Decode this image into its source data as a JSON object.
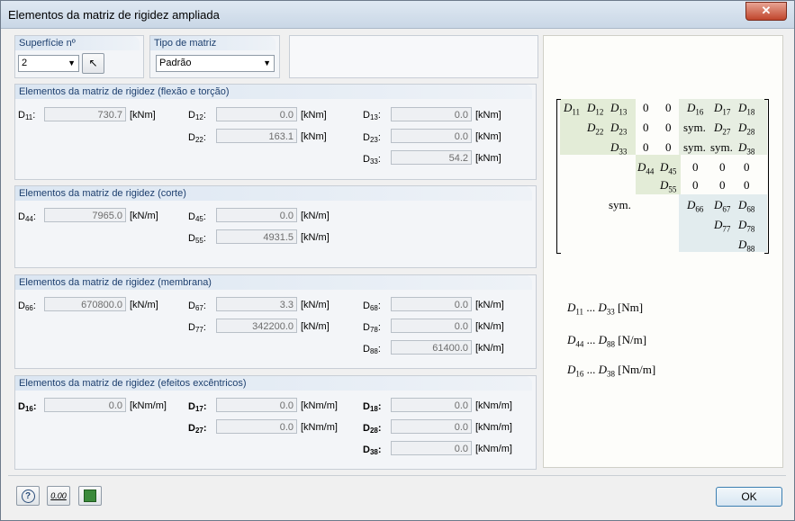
{
  "window": {
    "title": "Elementos da matriz de rigidez ampliada",
    "close": "✕"
  },
  "surface": {
    "label": "Superfície nº",
    "value": "2"
  },
  "matrix_type": {
    "label": "Tipo de matriz",
    "value": "Padrão"
  },
  "bending": {
    "title": "Elementos da matriz de rigidez (flexão e torção)",
    "d11": {
      "sym": "D",
      "sub": "11",
      "value": "730.7",
      "unit": "[kNm]"
    },
    "d12": {
      "sym": "D",
      "sub": "12",
      "value": "0.0",
      "unit": "[kNm]"
    },
    "d13": {
      "sym": "D",
      "sub": "13",
      "value": "0.0",
      "unit": "[kNm]"
    },
    "d22": {
      "sym": "D",
      "sub": "22",
      "value": "163.1",
      "unit": "[kNm]"
    },
    "d23": {
      "sym": "D",
      "sub": "23",
      "value": "0.0",
      "unit": "[kNm]"
    },
    "d33": {
      "sym": "D",
      "sub": "33",
      "value": "54.2",
      "unit": "[kNm]"
    }
  },
  "shear": {
    "title": "Elementos da matriz de rigidez (corte)",
    "d44": {
      "sym": "D",
      "sub": "44",
      "value": "7965.0",
      "unit": "[kN/m]"
    },
    "d45": {
      "sym": "D",
      "sub": "45",
      "value": "0.0",
      "unit": "[kN/m]"
    },
    "d55": {
      "sym": "D",
      "sub": "55",
      "value": "4931.5",
      "unit": "[kN/m]"
    }
  },
  "membrane": {
    "title": "Elementos da matriz de rigidez (membrana)",
    "d66": {
      "sym": "D",
      "sub": "66",
      "value": "670800.0",
      "unit": "[kN/m]"
    },
    "d67": {
      "sym": "D",
      "sub": "67",
      "value": "3.3",
      "unit": "[kN/m]"
    },
    "d68": {
      "sym": "D",
      "sub": "68",
      "value": "0.0",
      "unit": "[kN/m]"
    },
    "d77": {
      "sym": "D",
      "sub": "77",
      "value": "342200.0",
      "unit": "[kN/m]"
    },
    "d78": {
      "sym": "D",
      "sub": "78",
      "value": "0.0",
      "unit": "[kN/m]"
    },
    "d88": {
      "sym": "D",
      "sub": "88",
      "value": "61400.0",
      "unit": "[kN/m]"
    }
  },
  "eccentric": {
    "title": "Elementos da matriz de rigidez (efeitos excêntricos)",
    "d16": {
      "sym": "D",
      "sub": "16",
      "value": "0.0",
      "unit": "[kNm/m]"
    },
    "d17": {
      "sym": "D",
      "sub": "17",
      "value": "0.0",
      "unit": "[kNm/m]"
    },
    "d18": {
      "sym": "D",
      "sub": "18",
      "value": "0.0",
      "unit": "[kNm/m]"
    },
    "d27": {
      "sym": "D",
      "sub": "27",
      "value": "0.0",
      "unit": "[kNm/m]"
    },
    "d28": {
      "sym": "D",
      "sub": "28",
      "value": "0.0",
      "unit": "[kNm/m]"
    },
    "d38": {
      "sym": "D",
      "sub": "38",
      "value": "0.0",
      "unit": "[kNm/m]"
    }
  },
  "matrix": {
    "sym": "sym.",
    "zero": "0",
    "legend": [
      {
        "from": "D",
        "from_sub": "11",
        "dots": "...",
        "to": "D",
        "to_sub": "33",
        "unit": "[Nm]"
      },
      {
        "from": "D",
        "from_sub": "44",
        "dots": "...",
        "to": "D",
        "to_sub": "88",
        "unit": "[N/m]"
      },
      {
        "from": "D",
        "from_sub": "16",
        "dots": "...",
        "to": "D",
        "to_sub": "38",
        "unit": "[Nm/m]"
      }
    ]
  },
  "buttons": {
    "ok": "OK",
    "calc_icon": "0.00"
  }
}
